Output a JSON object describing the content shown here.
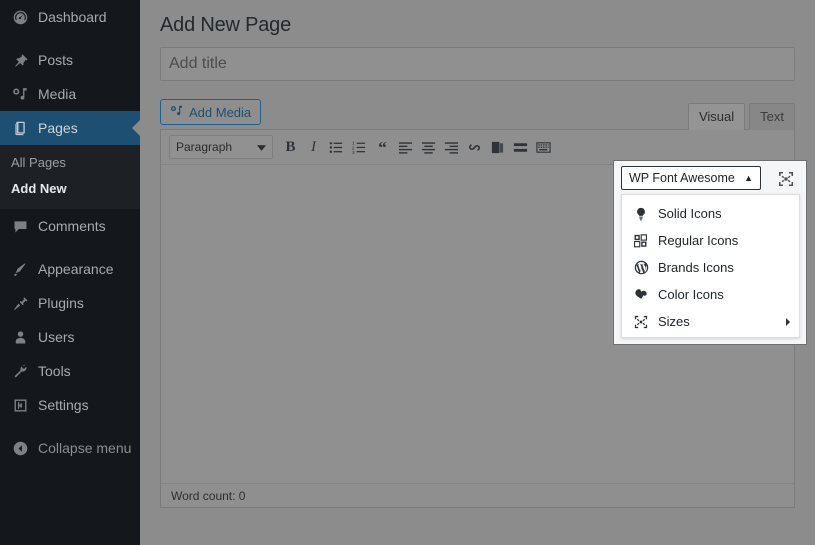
{
  "sidebar": {
    "items": [
      {
        "label": "Dashboard",
        "icon": "dashboard-icon",
        "current": false
      },
      {
        "label": "Posts",
        "icon": "pin-icon",
        "current": false
      },
      {
        "label": "Media",
        "icon": "media-icon",
        "current": false
      },
      {
        "label": "Pages",
        "icon": "pages-icon",
        "current": true
      },
      {
        "label": "Comments",
        "icon": "comments-icon",
        "current": false
      },
      {
        "label": "Appearance",
        "icon": "appearance-brush-icon",
        "current": false
      },
      {
        "label": "Plugins",
        "icon": "plugins-plug-icon",
        "current": false
      },
      {
        "label": "Users",
        "icon": "users-icon",
        "current": false
      },
      {
        "label": "Tools",
        "icon": "tools-wrench-icon",
        "current": false
      },
      {
        "label": "Settings",
        "icon": "settings-sliders-icon",
        "current": false
      }
    ],
    "submenu": [
      {
        "label": "All Pages",
        "current": false
      },
      {
        "label": "Add New",
        "current": true
      }
    ],
    "collapse_label": "Collapse menu"
  },
  "page": {
    "title": "Add New Page",
    "title_placeholder": "Add title",
    "title_value": ""
  },
  "media_bar": {
    "add_media_label": "Add Media",
    "tabs": [
      {
        "label": "Visual",
        "active": true
      },
      {
        "label": "Text",
        "active": false
      }
    ]
  },
  "editor": {
    "format_select": "Paragraph",
    "toolbar": [
      {
        "name": "bold-icon",
        "title": "Bold"
      },
      {
        "name": "italic-icon",
        "title": "Italic"
      },
      {
        "name": "bulleted-list-icon",
        "title": "Bulleted list"
      },
      {
        "name": "numbered-list-icon",
        "title": "Numbered list"
      },
      {
        "name": "blockquote-icon",
        "title": "Blockquote"
      },
      {
        "name": "align-left-icon",
        "title": "Align left"
      },
      {
        "name": "align-center-icon",
        "title": "Align center"
      },
      {
        "name": "align-right-icon",
        "title": "Align right"
      },
      {
        "name": "link-icon",
        "title": "Insert/edit link"
      },
      {
        "name": "read-more-icon",
        "title": "Insert Read More tag"
      },
      {
        "name": "page-break-icon",
        "title": "Insert Page Break tag"
      },
      {
        "name": "toolbar-toggle-icon",
        "title": "Toolbar Toggle"
      }
    ],
    "status": "Word count: 0",
    "content": ""
  },
  "fa_menu": {
    "toggle_label": "WP Font Awesome",
    "toggle_caret": "▲",
    "fullscreen_icon": "fullscreen-icon",
    "items": [
      {
        "label": "Solid Icons",
        "icon": "lightbulb-icon",
        "submenu": false
      },
      {
        "label": "Regular Icons",
        "icon": "grid-squares-icon",
        "submenu": false
      },
      {
        "label": "Brands Icons",
        "icon": "wordpress-logo-icon",
        "submenu": false
      },
      {
        "label": "Color Icons",
        "icon": "color-blob-icon",
        "submenu": false
      },
      {
        "label": "Sizes",
        "icon": "arrows-expand-icon",
        "submenu": true
      }
    ]
  },
  "colors": {
    "sidebar_bg": "#14181d",
    "sidebar_current": "#1d4f72",
    "accent": "#1d4f72",
    "overlay_dim": "#8c8c8c",
    "menu_bg": "#ffffff"
  }
}
